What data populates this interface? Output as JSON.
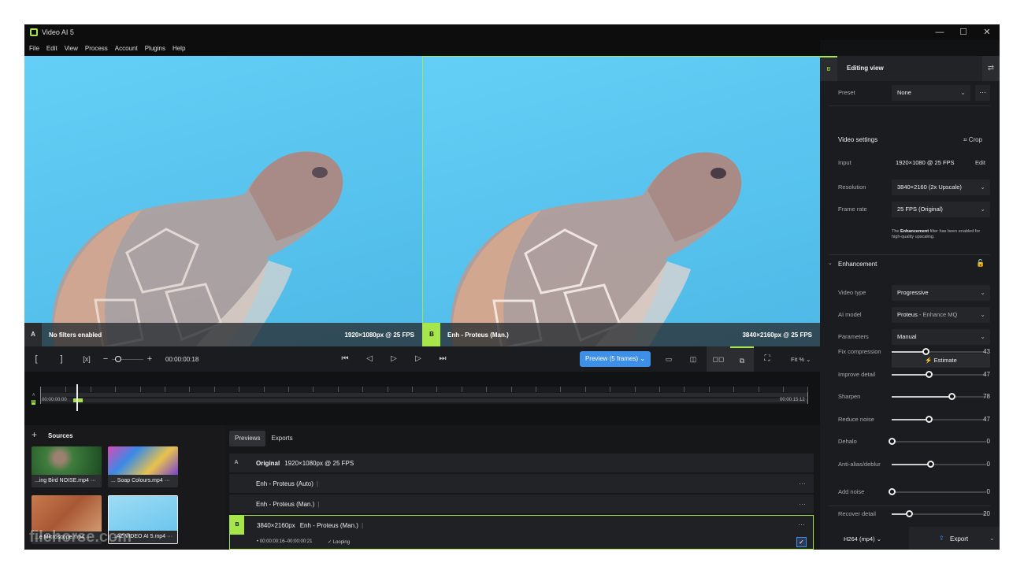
{
  "app": {
    "title": "Video AI 5"
  },
  "window_controls": {
    "min": "—",
    "max": "☐",
    "close": "✕"
  },
  "menu": [
    "File",
    "Edit",
    "View",
    "Process",
    "Account",
    "Plugins",
    "Help"
  ],
  "viewer": {
    "a": {
      "tag": "A",
      "label": "No filters enabled",
      "res": "1920×1080px @ 25 FPS"
    },
    "b": {
      "tag": "B",
      "label": "Enh - Proteus (Man.)",
      "res": "3840×2160px @ 25 FPS"
    }
  },
  "controls": {
    "mark_in": "[",
    "mark_out": "]",
    "clear": "[x]",
    "minus": "−",
    "plus": "+",
    "timecode": "00:00:00:18",
    "preview_btn": "Preview (5 frames)",
    "fit": "Fit %",
    "zoom_level": 0.1
  },
  "timeline": {
    "start": "00:00:00:00",
    "end": "00:00:15:12",
    "row_a": "A",
    "row_b": "B",
    "playhead_fraction": 0.046
  },
  "sources": {
    "title": "Sources",
    "add": "+",
    "items": [
      {
        "name": "...ing Bird NOISE.mp4",
        "color": "#3b6e3a"
      },
      {
        "name": "... Soap Colours.mp4",
        "color": "#7a5fc2"
      },
      {
        "name": "...e Microscope.mp4",
        "color": "#c2774a"
      },
      {
        "name": "...AZ VIDEO AI 5.mp4",
        "color": "#79c7e8"
      }
    ]
  },
  "previews": {
    "tabs": [
      "Previews",
      "Exports"
    ],
    "rows": [
      {
        "badge": "A",
        "res": "Original",
        "label": "1920×1080px @ 25 FPS"
      },
      {
        "badge": "",
        "res": "",
        "label": "Enh - Proteus (Auto)"
      },
      {
        "badge": "",
        "res": "",
        "label": "Enh - Proteus (Man.)"
      },
      {
        "badge": "B",
        "res": "3840×2160px",
        "label": "Enh - Proteus (Man.)"
      }
    ],
    "sub": {
      "range": "00:00:00:16–00:00:00:21",
      "looping": "Looping"
    }
  },
  "panel": {
    "badge": "B",
    "title": "Editing view",
    "preset_label": "Preset",
    "preset_value": "None",
    "video_settings": "Video settings",
    "crop": "Crop",
    "input_label": "Input",
    "input_value": "1920×1080 @ 25 FPS",
    "edit": "Edit",
    "resolution_label": "Resolution",
    "resolution_value": "3840×2160 (2x Upscale)",
    "framerate_label": "Frame rate",
    "framerate_value": "25 FPS (Original)",
    "note_prefix": "The",
    "note_bold": "Enhancement",
    "note_rest": "filter has been enabled for high-quality upscaling.",
    "enhancement": "Enhancement",
    "videotype_label": "Video type",
    "videotype_value": "Progressive",
    "aimodel_label": "AI model",
    "aimodel_value": "Proteus",
    "aimodel_sub": " - Enhance MQ",
    "params_label": "Parameters",
    "params_value": "Manual",
    "estimate": "Estimate",
    "sliders": [
      {
        "label": "Fix compression",
        "value": "43",
        "pct": 0.36
      },
      {
        "label": "Improve detail",
        "value": "47",
        "pct": 0.39
      },
      {
        "label": "Sharpen",
        "value": "78",
        "pct": 0.63
      },
      {
        "label": "Reduce noise",
        "value": "47",
        "pct": 0.39
      },
      {
        "label": "Dehalo",
        "value": "0",
        "pct": 0.0
      },
      {
        "label": "Anti-alias/deblur",
        "value": "0",
        "pct": 0.41
      },
      {
        "label": "Add noise",
        "value": "0",
        "pct": 0.0
      },
      {
        "label": "Recover detail",
        "value": "20",
        "pct": 0.18
      }
    ],
    "format": "H264 (mp4)",
    "export": "Export"
  },
  "watermark": "filehorse.com"
}
